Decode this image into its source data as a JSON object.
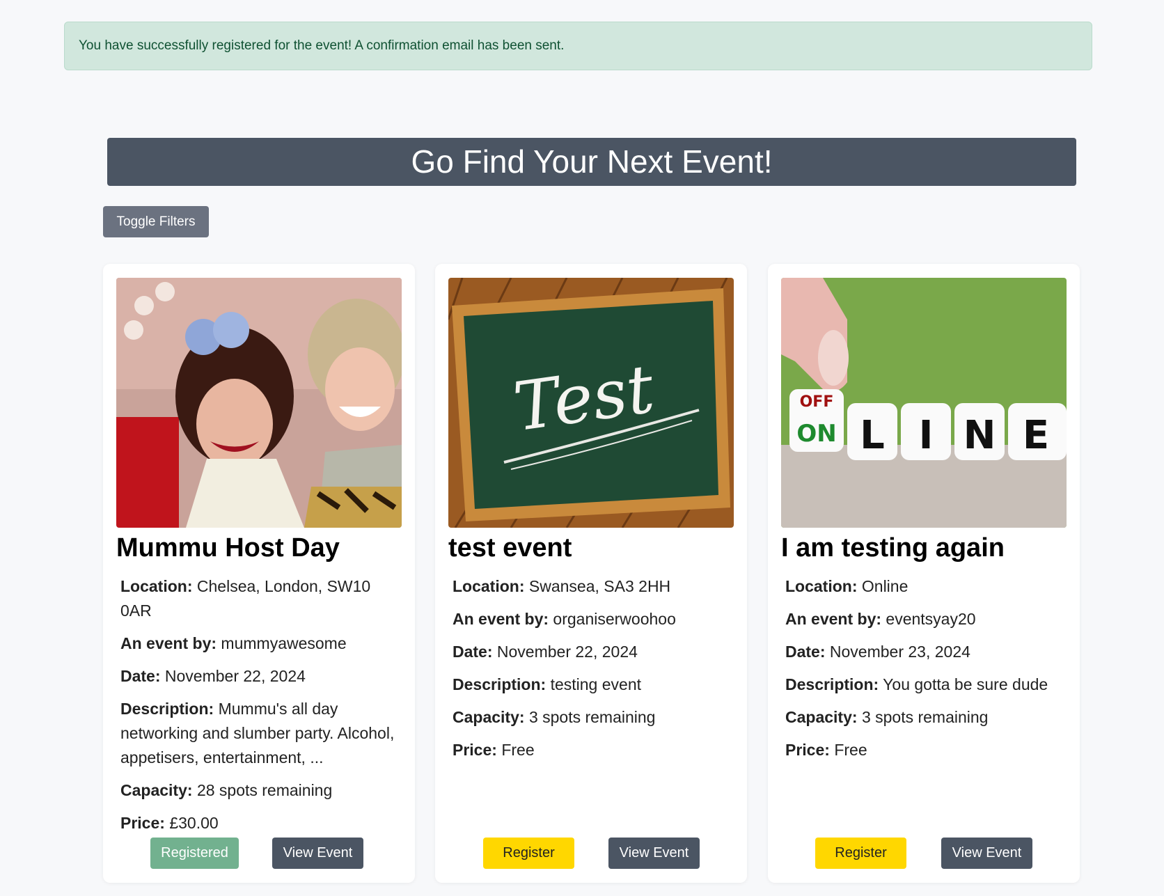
{
  "alert": {
    "message": "You have successfully registered for the event! A confirmation email has been sent."
  },
  "hero": {
    "title": "Go Find Your Next Event!"
  },
  "filters": {
    "toggle_label": "Toggle Filters"
  },
  "labels": {
    "location": "Location:",
    "organiser": "An event by:",
    "date": "Date:",
    "description": "Description:",
    "capacity": "Capacity:",
    "price": "Price:"
  },
  "events": [
    {
      "title": "Mummu Host Day",
      "location": "Chelsea, London, SW10 0AR",
      "organiser": "mummyawesome",
      "date": "November 22, 2024",
      "description": "Mummu's all day networking and slumber party. Alcohol, appetisers, entertainment, ...",
      "capacity": "28 spots remaining",
      "price": "£30.00",
      "action_label": "Registered",
      "view_label": "View Event",
      "image": "party-photo"
    },
    {
      "title": "test event",
      "location": "Swansea, SA3 2HH",
      "organiser": "organiserwoohoo",
      "date": "November 22, 2024",
      "description": "testing event",
      "capacity": "3 spots remaining",
      "price": "Free",
      "action_label": "Register",
      "view_label": "View Event",
      "image": "chalkboard",
      "image_text": "Test"
    },
    {
      "title": "I am testing again",
      "location": "Online",
      "organiser": "eventsyay20",
      "date": "November 23, 2024",
      "description": "You gotta be sure dude",
      "capacity": "3 spots remaining",
      "price": "Free",
      "action_label": "Register",
      "view_label": "View Event",
      "image": "dice-blocks",
      "image_text": {
        "off": "OFF",
        "on": "ON",
        "letters": [
          "L",
          "I",
          "N",
          "E"
        ]
      }
    }
  ],
  "colors": {
    "alert_bg": "#d1e7dd",
    "hero_bg": "#4b5563",
    "register": "#ffd700",
    "registered": "#72b18f"
  }
}
